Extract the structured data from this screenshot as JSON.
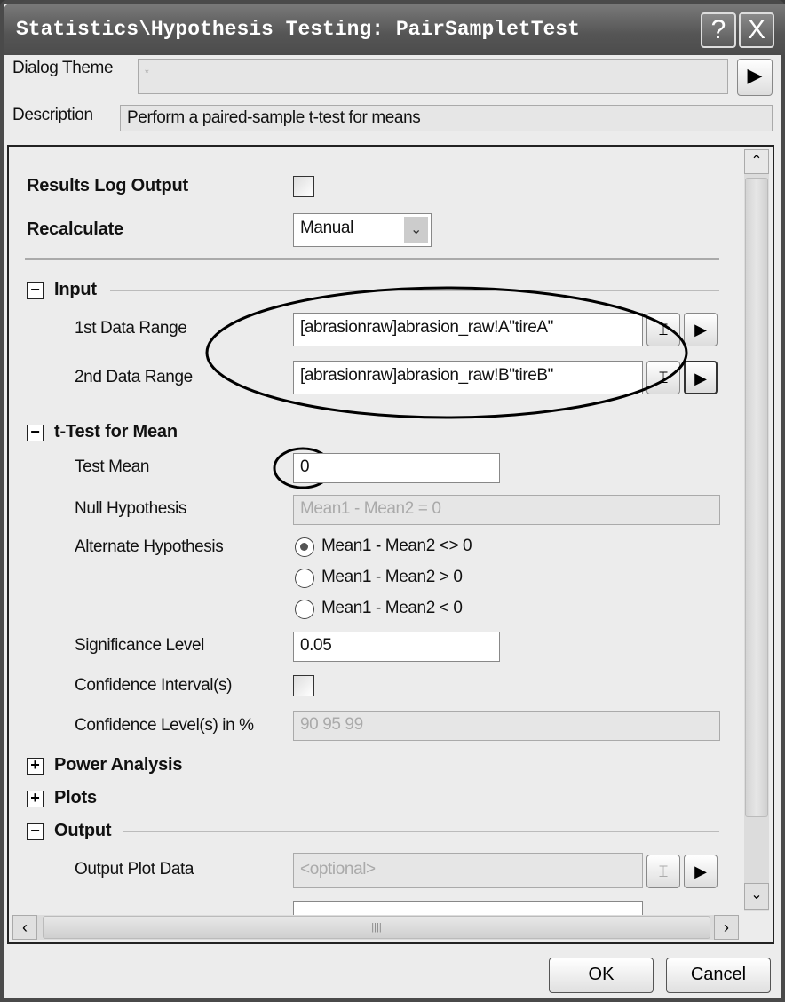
{
  "window": {
    "title": "Statistics\\Hypothesis Testing: PairSampletTest",
    "help": "?",
    "close": "X"
  },
  "header": {
    "theme_label": "Dialog Theme",
    "theme_value": "*",
    "description_label": "Description",
    "description_value": "Perform a paired-sample t-test for means"
  },
  "form": {
    "results_log_label": "Results Log Output",
    "results_log_checked": false,
    "recalculate_label": "Recalculate",
    "recalculate_value": "Manual",
    "input": {
      "header": "Input",
      "expanded": true,
      "range1_label": "1st Data Range",
      "range1_value": "[abrasionraw]abrasion_raw!A\"tireA\"",
      "range2_label": "2nd Data Range",
      "range2_value": "[abrasionraw]abrasion_raw!B\"tireB\""
    },
    "ttest": {
      "header": "t-Test for Mean",
      "expanded": true,
      "test_mean_label": "Test Mean",
      "test_mean_value": "0",
      "null_label": "Null Hypothesis",
      "null_value": "Mean1 - Mean2 = 0",
      "alt_label": "Alternate Hypothesis",
      "alt_options": [
        "Mean1 - Mean2 <> 0",
        "Mean1 - Mean2 > 0",
        "Mean1 - Mean2 < 0"
      ],
      "alt_selected": 0,
      "sig_label": "Significance Level",
      "sig_value": "0.05",
      "ci_label": "Confidence Interval(s)",
      "ci_checked": false,
      "cl_label": "Confidence Level(s) in %",
      "cl_value": "90 95 99"
    },
    "power": {
      "header": "Power Analysis",
      "expanded": false
    },
    "plots": {
      "header": "Plots",
      "expanded": false
    },
    "output": {
      "header": "Output",
      "expanded": true,
      "plot_data_label": "Output Plot Data",
      "plot_data_placeholder": "<optional>"
    }
  },
  "buttons": {
    "ok": "OK",
    "cancel": "Cancel"
  }
}
